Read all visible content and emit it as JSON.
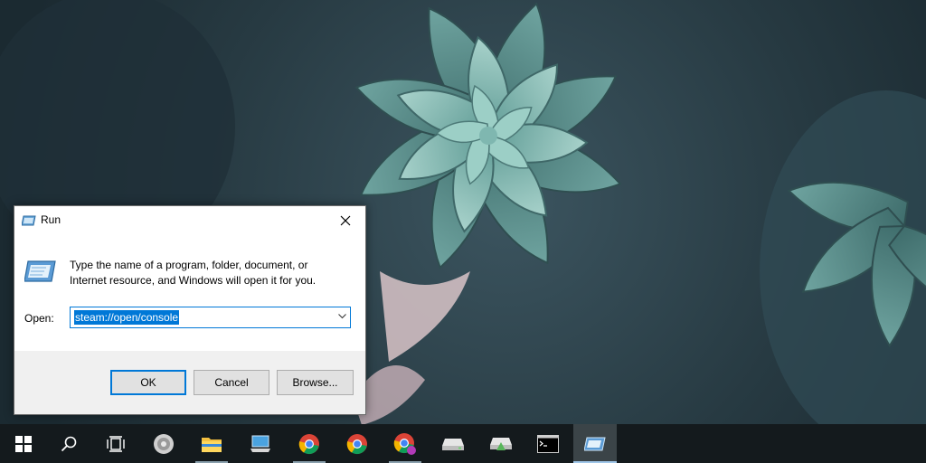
{
  "dialog": {
    "title": "Run",
    "title_icon": "run-icon",
    "close_icon": "close-icon",
    "description": "Type the name of a program, folder, document, or Internet resource, and Windows will open it for you.",
    "open_label": "Open:",
    "open_value": "steam://open/console",
    "buttons": {
      "ok": "OK",
      "cancel": "Cancel",
      "browse": "Browse..."
    }
  },
  "taskbar": {
    "items": [
      {
        "icon": "windows-start-icon"
      },
      {
        "icon": "search-icon"
      },
      {
        "icon": "task-view-icon"
      },
      {
        "icon": "speaker-icon"
      },
      {
        "icon": "folder-icon",
        "open": true
      },
      {
        "icon": "this-pc-icon"
      },
      {
        "icon": "chrome-icon",
        "open": true
      },
      {
        "icon": "chrome-icon"
      },
      {
        "icon": "chrome-profile-icon",
        "open": true
      },
      {
        "icon": "drive-icon"
      },
      {
        "icon": "network-drive-icon"
      },
      {
        "icon": "command-prompt-icon"
      },
      {
        "icon": "run-icon",
        "active": true
      }
    ]
  },
  "colors": {
    "accent": "#0078d7",
    "taskbar": "#141a1d",
    "dialog_bg": "#f0f0f0",
    "button_bg": "#e1e1e1"
  }
}
